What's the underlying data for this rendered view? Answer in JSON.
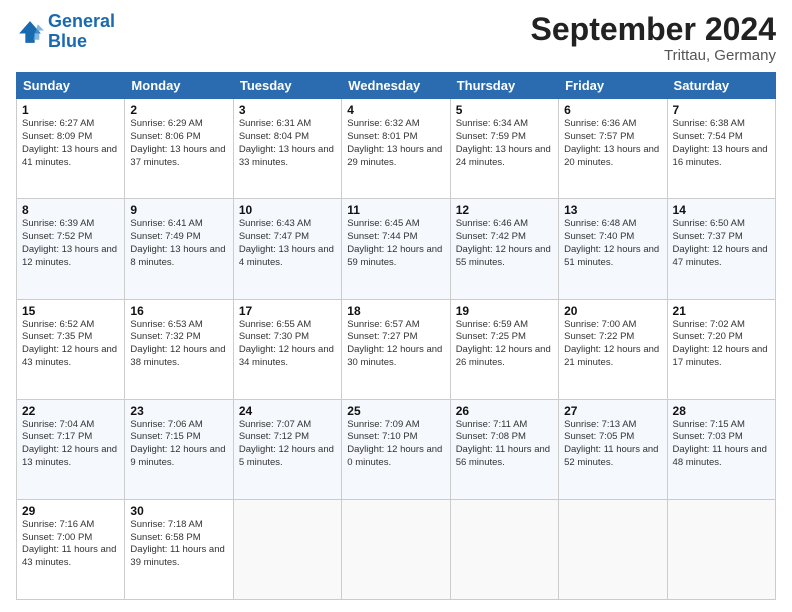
{
  "header": {
    "logo_line1": "General",
    "logo_line2": "Blue",
    "title": "September 2024",
    "location": "Trittau, Germany"
  },
  "days_of_week": [
    "Sunday",
    "Monday",
    "Tuesday",
    "Wednesday",
    "Thursday",
    "Friday",
    "Saturday"
  ],
  "weeks": [
    [
      {
        "day": "1",
        "info": "Sunrise: 6:27 AM\nSunset: 8:09 PM\nDaylight: 13 hours\nand 41 minutes."
      },
      {
        "day": "2",
        "info": "Sunrise: 6:29 AM\nSunset: 8:06 PM\nDaylight: 13 hours\nand 37 minutes."
      },
      {
        "day": "3",
        "info": "Sunrise: 6:31 AM\nSunset: 8:04 PM\nDaylight: 13 hours\nand 33 minutes."
      },
      {
        "day": "4",
        "info": "Sunrise: 6:32 AM\nSunset: 8:01 PM\nDaylight: 13 hours\nand 29 minutes."
      },
      {
        "day": "5",
        "info": "Sunrise: 6:34 AM\nSunset: 7:59 PM\nDaylight: 13 hours\nand 24 minutes."
      },
      {
        "day": "6",
        "info": "Sunrise: 6:36 AM\nSunset: 7:57 PM\nDaylight: 13 hours\nand 20 minutes."
      },
      {
        "day": "7",
        "info": "Sunrise: 6:38 AM\nSunset: 7:54 PM\nDaylight: 13 hours\nand 16 minutes."
      }
    ],
    [
      {
        "day": "8",
        "info": "Sunrise: 6:39 AM\nSunset: 7:52 PM\nDaylight: 13 hours\nand 12 minutes."
      },
      {
        "day": "9",
        "info": "Sunrise: 6:41 AM\nSunset: 7:49 PM\nDaylight: 13 hours\nand 8 minutes."
      },
      {
        "day": "10",
        "info": "Sunrise: 6:43 AM\nSunset: 7:47 PM\nDaylight: 13 hours\nand 4 minutes."
      },
      {
        "day": "11",
        "info": "Sunrise: 6:45 AM\nSunset: 7:44 PM\nDaylight: 12 hours\nand 59 minutes."
      },
      {
        "day": "12",
        "info": "Sunrise: 6:46 AM\nSunset: 7:42 PM\nDaylight: 12 hours\nand 55 minutes."
      },
      {
        "day": "13",
        "info": "Sunrise: 6:48 AM\nSunset: 7:40 PM\nDaylight: 12 hours\nand 51 minutes."
      },
      {
        "day": "14",
        "info": "Sunrise: 6:50 AM\nSunset: 7:37 PM\nDaylight: 12 hours\nand 47 minutes."
      }
    ],
    [
      {
        "day": "15",
        "info": "Sunrise: 6:52 AM\nSunset: 7:35 PM\nDaylight: 12 hours\nand 43 minutes."
      },
      {
        "day": "16",
        "info": "Sunrise: 6:53 AM\nSunset: 7:32 PM\nDaylight: 12 hours\nand 38 minutes."
      },
      {
        "day": "17",
        "info": "Sunrise: 6:55 AM\nSunset: 7:30 PM\nDaylight: 12 hours\nand 34 minutes."
      },
      {
        "day": "18",
        "info": "Sunrise: 6:57 AM\nSunset: 7:27 PM\nDaylight: 12 hours\nand 30 minutes."
      },
      {
        "day": "19",
        "info": "Sunrise: 6:59 AM\nSunset: 7:25 PM\nDaylight: 12 hours\nand 26 minutes."
      },
      {
        "day": "20",
        "info": "Sunrise: 7:00 AM\nSunset: 7:22 PM\nDaylight: 12 hours\nand 21 minutes."
      },
      {
        "day": "21",
        "info": "Sunrise: 7:02 AM\nSunset: 7:20 PM\nDaylight: 12 hours\nand 17 minutes."
      }
    ],
    [
      {
        "day": "22",
        "info": "Sunrise: 7:04 AM\nSunset: 7:17 PM\nDaylight: 12 hours\nand 13 minutes."
      },
      {
        "day": "23",
        "info": "Sunrise: 7:06 AM\nSunset: 7:15 PM\nDaylight: 12 hours\nand 9 minutes."
      },
      {
        "day": "24",
        "info": "Sunrise: 7:07 AM\nSunset: 7:12 PM\nDaylight: 12 hours\nand 5 minutes."
      },
      {
        "day": "25",
        "info": "Sunrise: 7:09 AM\nSunset: 7:10 PM\nDaylight: 12 hours\nand 0 minutes."
      },
      {
        "day": "26",
        "info": "Sunrise: 7:11 AM\nSunset: 7:08 PM\nDaylight: 11 hours\nand 56 minutes."
      },
      {
        "day": "27",
        "info": "Sunrise: 7:13 AM\nSunset: 7:05 PM\nDaylight: 11 hours\nand 52 minutes."
      },
      {
        "day": "28",
        "info": "Sunrise: 7:15 AM\nSunset: 7:03 PM\nDaylight: 11 hours\nand 48 minutes."
      }
    ],
    [
      {
        "day": "29",
        "info": "Sunrise: 7:16 AM\nSunset: 7:00 PM\nDaylight: 11 hours\nand 43 minutes."
      },
      {
        "day": "30",
        "info": "Sunrise: 7:18 AM\nSunset: 6:58 PM\nDaylight: 11 hours\nand 39 minutes."
      },
      null,
      null,
      null,
      null,
      null
    ]
  ]
}
